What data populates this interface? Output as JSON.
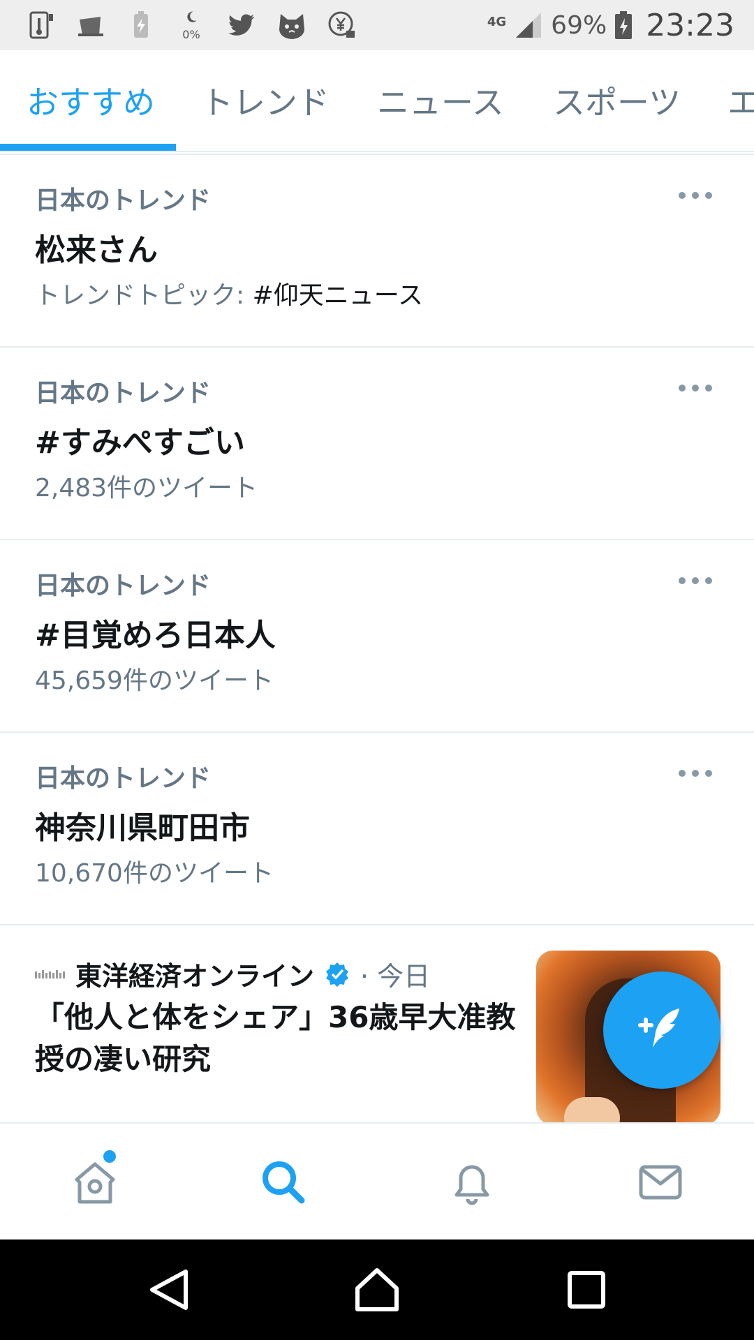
{
  "status_bar": {
    "network": "4G",
    "battery_percent": "69%",
    "time": "23:23",
    "zero_percent_label": "0%",
    "icons": [
      "thermometer-icon",
      "cup-icon",
      "battery-charging-icon",
      "moon-icon",
      "twitter-bird-icon",
      "cat-face-icon",
      "yen-lock-icon",
      "signal-icon",
      "battery-icon"
    ]
  },
  "tabs": {
    "items": [
      {
        "label": "おすすめ",
        "active": true
      },
      {
        "label": "トレンド",
        "active": false
      },
      {
        "label": "ニュース",
        "active": false
      },
      {
        "label": "スポーツ",
        "active": false
      },
      {
        "label": "エ",
        "active": false
      }
    ]
  },
  "trends": [
    {
      "context": "日本のトレンド",
      "title": "松来さん",
      "meta_prefix": "トレンドトピック: ",
      "meta_strong": "#仰天ニュース"
    },
    {
      "context": "日本のトレンド",
      "title": "#すみぺすごい",
      "meta": "2,483件のツイート"
    },
    {
      "context": "日本のトレンド",
      "title": "#目覚めろ日本人",
      "meta": "45,659件のツイート"
    },
    {
      "context": "日本のトレンド",
      "title": "神奈川県町田市",
      "meta": "10,670件のツイート"
    }
  ],
  "news": {
    "source": "東洋経済オンライン",
    "time": "· 今日",
    "headline": "「他人と体をシェア」36歳早大准教授の凄い研究"
  },
  "colors": {
    "accent": "#1da1f2",
    "secondary_text": "#657786",
    "primary_text": "#14171a"
  },
  "bottom_nav": [
    "home-icon",
    "search-icon",
    "bell-icon",
    "mail-icon"
  ],
  "android_nav": [
    "back-icon",
    "home-button-icon",
    "recents-icon"
  ]
}
